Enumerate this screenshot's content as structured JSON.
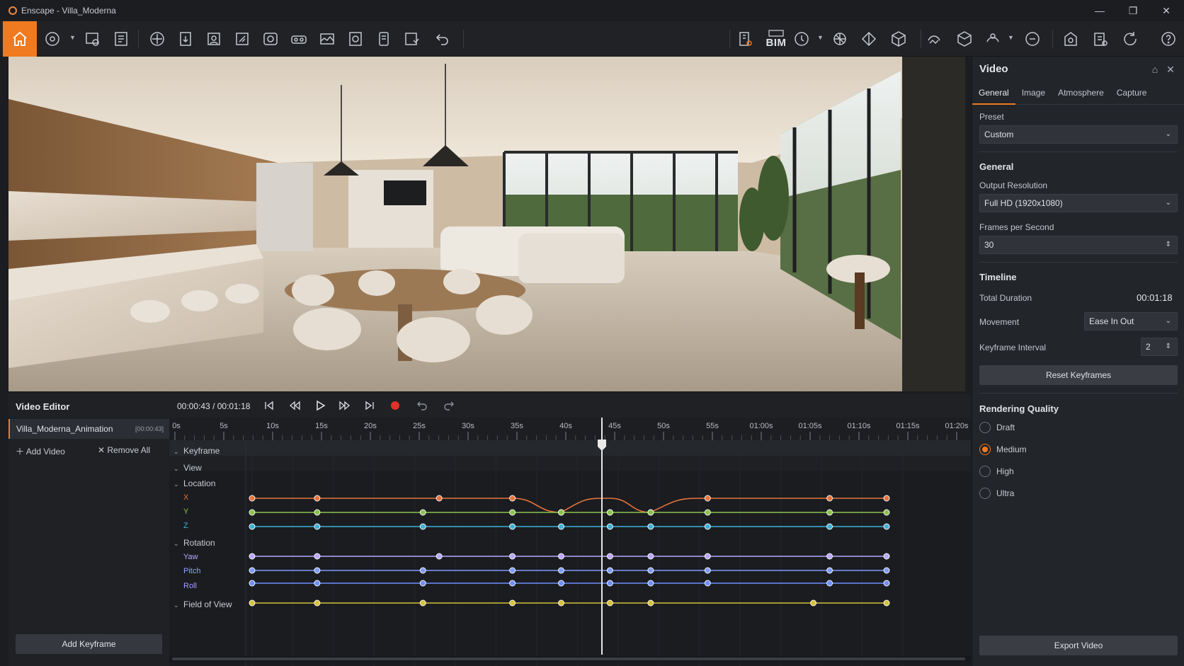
{
  "window": {
    "title": "Enscape - Villa_Moderna",
    "controls": {
      "minimize": "—",
      "maximize": "❐",
      "close": "✕"
    }
  },
  "toolbar": {
    "bim_label": "BIM",
    "icons": [
      "home-icon",
      "view-settings-icon",
      "screenshot-icon",
      "batch-render-icon",
      "compass-icon",
      "export-icon",
      "asset-library-icon",
      "material-editor-icon",
      "camera-icon",
      "vr-icon",
      "panorama-icon",
      "render-settings-icon",
      "video-clip-icon",
      "upload-icon",
      "undo-icon",
      "bim-panel-icon",
      "bim-icon",
      "light-view-icon",
      "sun-icon",
      "site-context-icon",
      "cube-icon",
      "walk-mode-icon",
      "section-box-icon",
      "atmosphere-icon",
      "feedback-icon",
      "collaboration-icon",
      "clipboard-icon",
      "sync-icon",
      "help-icon"
    ]
  },
  "panel": {
    "title": "Video",
    "tabs": [
      "General",
      "Image",
      "Atmosphere",
      "Capture"
    ],
    "active_tab": "General",
    "preset_label": "Preset",
    "preset_value": "Custom",
    "general_heading": "General",
    "output_resolution_label": "Output Resolution",
    "output_resolution_value": "Full HD (1920x1080)",
    "fps_label": "Frames per Second",
    "fps_value": "30",
    "timeline_heading": "Timeline",
    "total_duration_label": "Total Duration",
    "total_duration_value": "00:01:18",
    "movement_label": "Movement",
    "movement_value": "Ease In Out",
    "keyframe_interval_label": "Keyframe Interval",
    "keyframe_interval_value": "2",
    "reset_button": "Reset Keyframes",
    "quality_heading": "Rendering Quality",
    "quality_options": [
      "Draft",
      "Medium",
      "High",
      "Ultra"
    ],
    "quality_selected": "Medium",
    "export_button": "Export Video"
  },
  "video_editor": {
    "title": "Video Editor",
    "videos": [
      {
        "name": "Villa_Moderna_Animation",
        "duration": "[00:00:43]"
      }
    ],
    "add_video": "Add Video",
    "remove_all": "Remove All",
    "add_keyframe": "Add Keyframe"
  },
  "transport": {
    "current_time": "00:00:43",
    "separator": "/",
    "total_time": "00:01:18"
  },
  "timeline": {
    "ticks": [
      "0s",
      "5s",
      "10s",
      "15s",
      "20s",
      "25s",
      "30s",
      "35s",
      "40s",
      "45s",
      "50s",
      "55s",
      "01:00s",
      "01:05s",
      "01:10s",
      "01:15s",
      "01:20s"
    ],
    "playhead_seconds": 43,
    "tracks": {
      "keyframe": "Keyframe",
      "view": "View",
      "location": "Location",
      "x": "X",
      "y": "Y",
      "z": "Z",
      "rotation": "Rotation",
      "yaw": "Yaw",
      "pitch": "Pitch",
      "roll": "Roll",
      "fov": "Field of View"
    },
    "colors": {
      "x": "#e8743b",
      "y": "#8bc34a",
      "z": "#3fb1d6",
      "yaw": "#b9a8ff",
      "pitch": "#7f9cff",
      "roll": "#6f8fff",
      "fov": "#d8c238",
      "accent": "#f07a1f"
    },
    "keyframe_seconds": {
      "x": [
        0,
        8,
        23,
        32,
        38,
        44,
        49,
        56,
        71,
        78
      ],
      "y": [
        0,
        8,
        21,
        32,
        38,
        44,
        49,
        56,
        71,
        78
      ],
      "z": [
        0,
        8,
        21,
        32,
        38,
        44,
        49,
        56,
        71,
        78
      ],
      "yaw": [
        0,
        8,
        23,
        32,
        38,
        44,
        49,
        56,
        71,
        78
      ],
      "pitch": [
        0,
        8,
        21,
        32,
        38,
        44,
        49,
        56,
        71,
        78
      ],
      "roll": [
        0,
        8,
        21,
        32,
        38,
        44,
        49,
        56,
        71,
        78
      ],
      "fov": [
        0,
        8,
        21,
        32,
        38,
        44,
        49,
        69,
        78
      ]
    }
  }
}
